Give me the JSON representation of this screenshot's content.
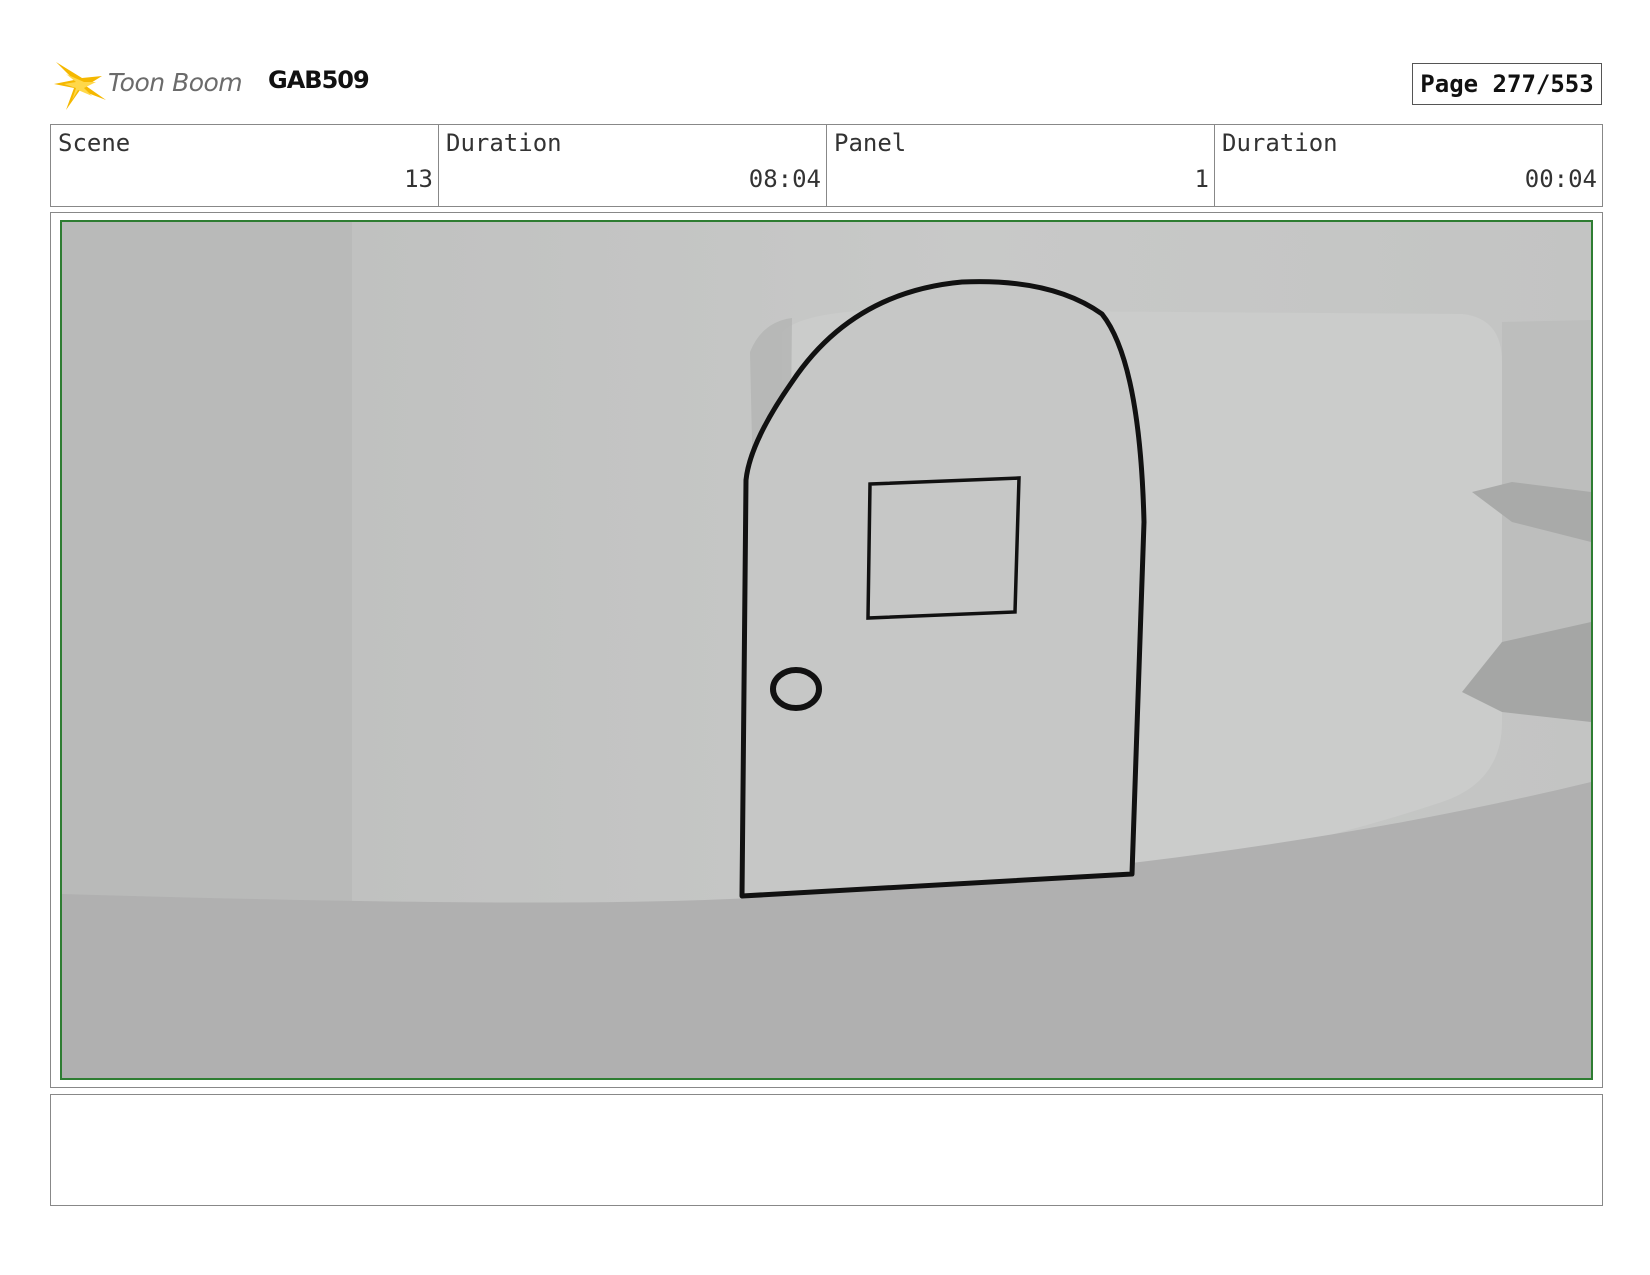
{
  "header": {
    "logo_text": "Toon Boom",
    "project_code": "GAB509",
    "page_label": "Page 277/553"
  },
  "info": [
    {
      "label": "Scene",
      "value": "13"
    },
    {
      "label": "Duration",
      "value": "08:04"
    },
    {
      "label": "Panel",
      "value": "1"
    },
    {
      "label": "Duration",
      "value": "00:04"
    }
  ],
  "panel": {
    "frame_color": "#2e7d32"
  },
  "notes": {
    "text": ""
  }
}
